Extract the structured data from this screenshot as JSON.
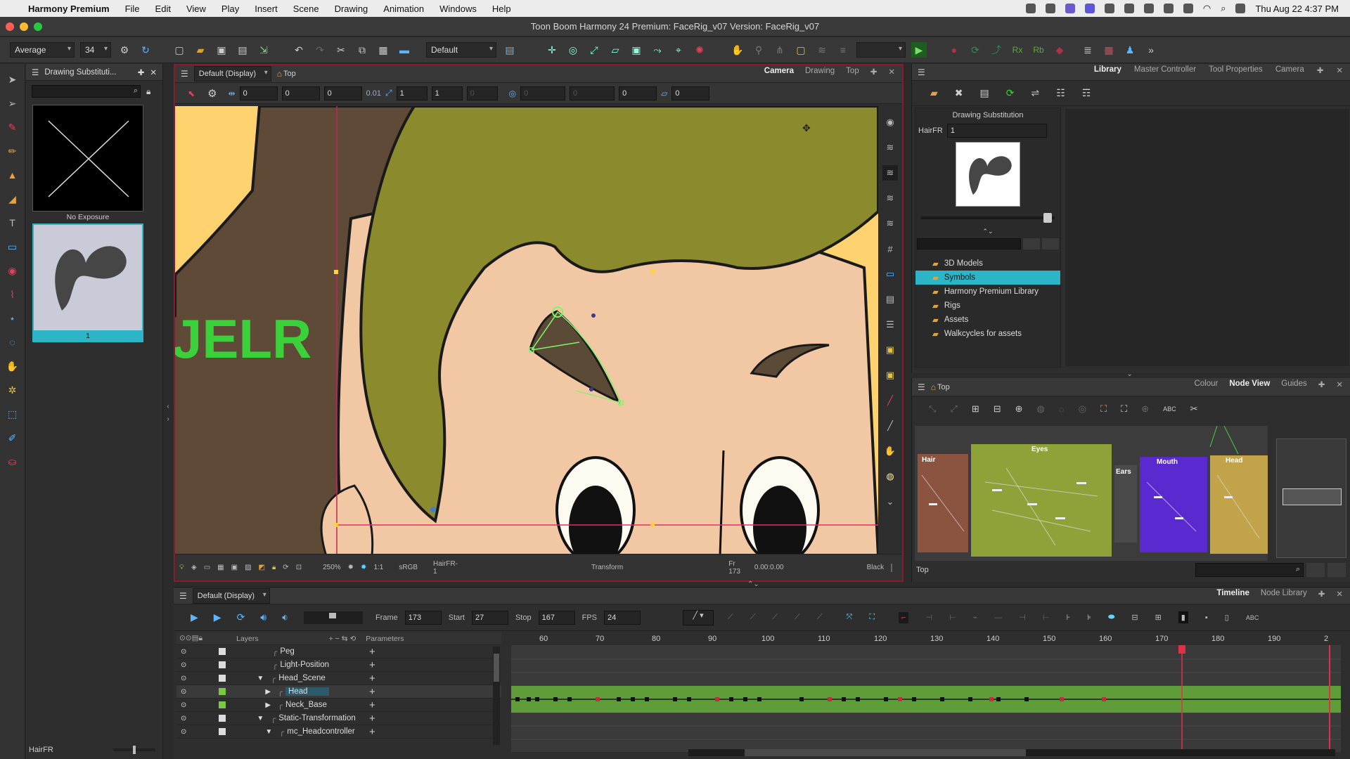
{
  "menubar": {
    "app": "Harmony Premium",
    "items": [
      "File",
      "Edit",
      "View",
      "Play",
      "Insert",
      "Scene",
      "Drawing",
      "Animation",
      "Windows",
      "Help"
    ],
    "clock": "Thu Aug 22  4:37 PM"
  },
  "window": {
    "title": "Toon Boom Harmony 24 Premium: FaceRig_v07 Version: FaceRig_v07"
  },
  "toolbar": {
    "brush_mode": "Average",
    "brush_size": "34",
    "preset": "Default"
  },
  "drawsub": {
    "title": "Drawing Substituti...",
    "cells": [
      {
        "label": "No Exposure"
      },
      {
        "label": "1"
      }
    ],
    "footer": "HairFR"
  },
  "viewer": {
    "display": "Default (Display)",
    "view_label": "Top",
    "tabs": [
      "Camera",
      "Drawing",
      "Top"
    ],
    "fields": [
      "0",
      "0",
      "0",
      "0.01",
      "1",
      "1",
      "0",
      "0",
      "0",
      "0",
      "0"
    ],
    "canvas_text": "JELR",
    "status": {
      "zoom": "250%",
      "ratio": "1:1",
      "colorspace": "sRGB",
      "drawing": "HairFR-1",
      "tool": "Transform",
      "frame": "Fr 173",
      "coords": "0.00:0.00",
      "color": "Black"
    }
  },
  "library": {
    "tabs": [
      "Library",
      "Master Controller",
      "Tool Properties",
      "Camera"
    ],
    "panel_title": "Drawing Substitution",
    "field_label": "HairFR",
    "field_value": "1",
    "tree": [
      "3D Models",
      "Symbols",
      "Harmony Premium Library",
      "Rigs",
      "Assets",
      "Walkcycles for assets"
    ],
    "selected": "Symbols"
  },
  "nodeview": {
    "label": "Top",
    "tabs": [
      "Colour",
      "Node View",
      "Guides"
    ],
    "groups": [
      "Hair",
      "Eyes",
      "Ears",
      "Mouth",
      "Head"
    ],
    "footer": "Top"
  },
  "timeline": {
    "display": "Default (Display)",
    "tabs": [
      "Timeline",
      "Node Library"
    ],
    "frame_label": "Frame",
    "frame": "173",
    "start_label": "Start",
    "start": "27",
    "stop_label": "Stop",
    "stop": "167",
    "fps_label": "FPS",
    "fps": "24",
    "layers_label": "Layers",
    "params_label": "Parameters",
    "ruler": [
      "60",
      "70",
      "80",
      "90",
      "100",
      "110",
      "120",
      "130",
      "140",
      "150",
      "160",
      "170",
      "180",
      "190",
      "2"
    ],
    "layers": [
      "Peg",
      "Light-Position",
      "Head_Scene",
      "Head",
      "Neck_Base",
      "Static-Transformation",
      "mc_Headcontroller"
    ]
  },
  "colors": {
    "accent": "#2bb5c6",
    "selection": "#e0314a",
    "hair": "#8b8a2c",
    "skin": "#f2c7a4"
  }
}
